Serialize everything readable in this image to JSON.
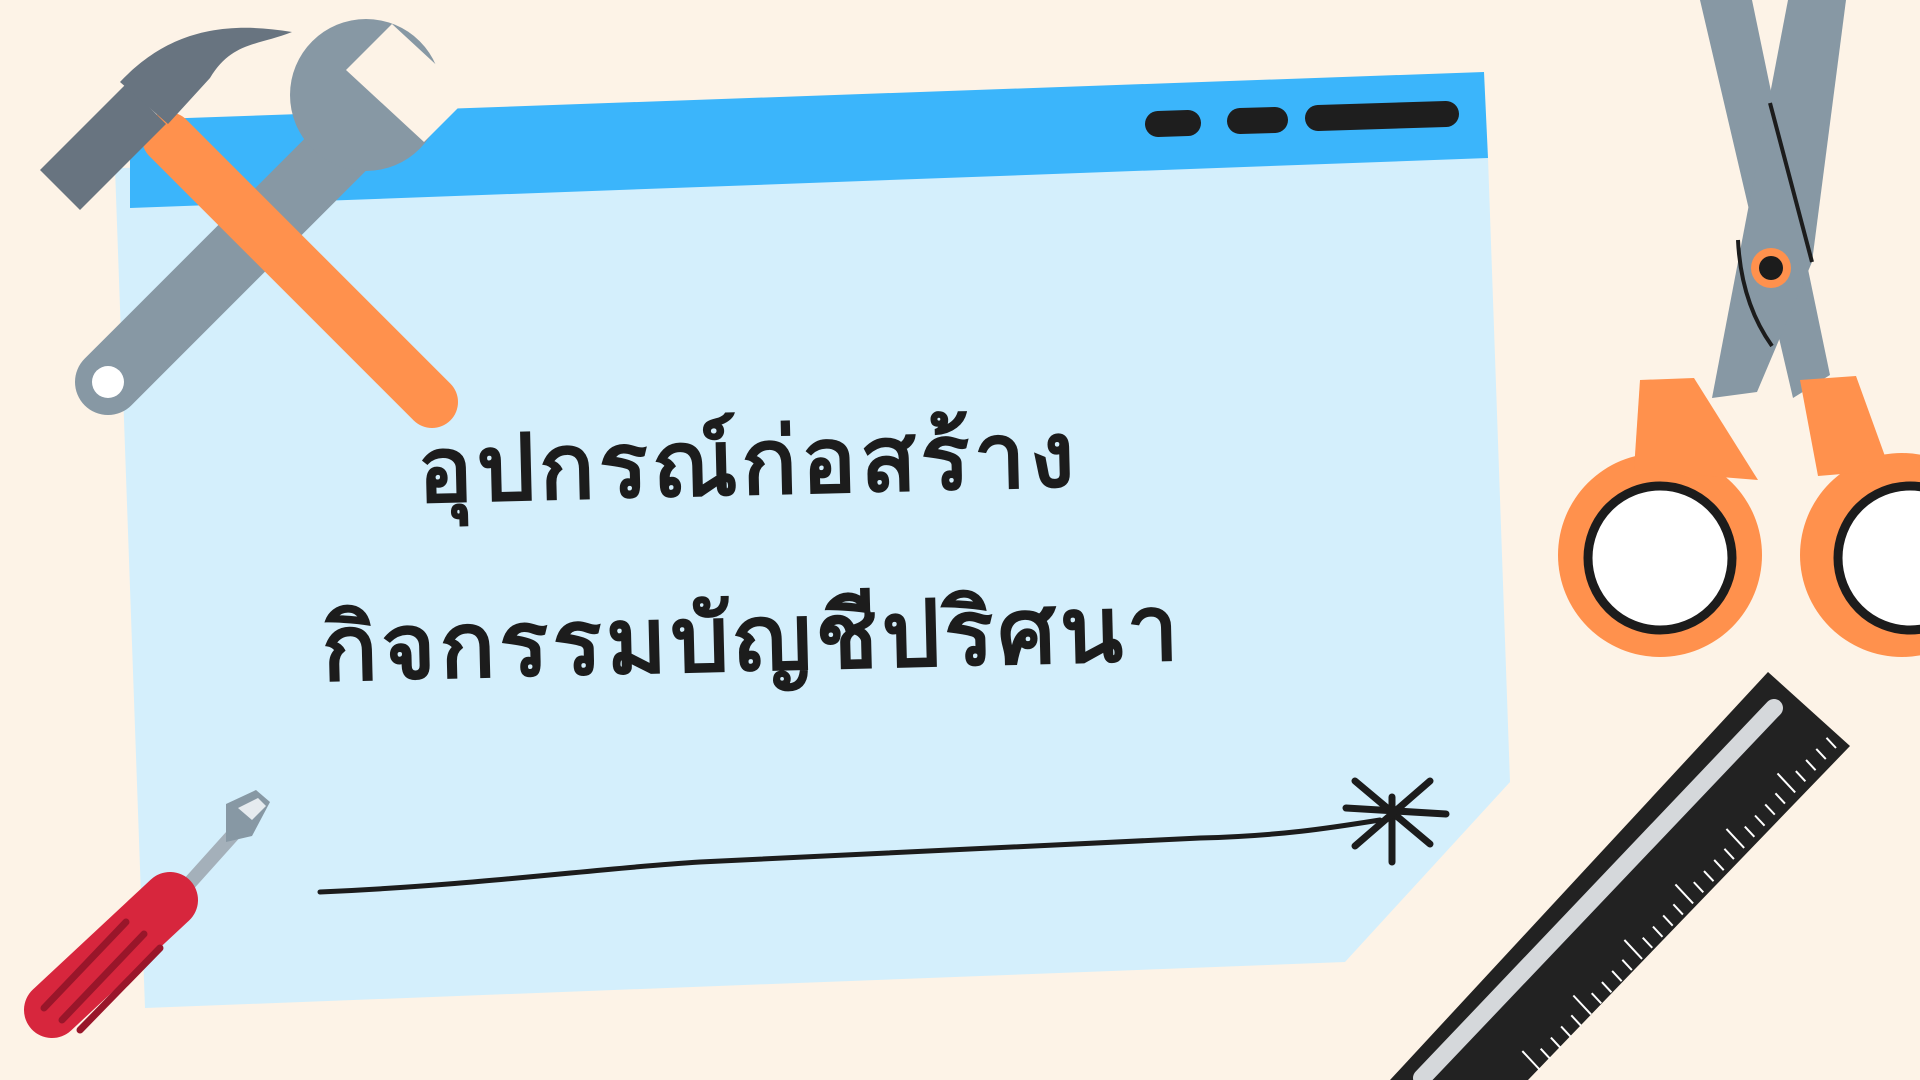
{
  "title": {
    "line1": "อุปกรณ์ก่อสร้าง",
    "line2": "กิจกรรมบัญชีปริศนา",
    "text_color": "#1c1c1c"
  },
  "window": {
    "titlebar_color": "#3bb5fb",
    "body_color": "#d4effc"
  },
  "colors": {
    "background": "#fdf3e7",
    "tool_orange": "#ff914d",
    "tool_gray": "#8798a4",
    "tool_dark_gray": "#687480",
    "screwdriver_red": "#d7263d",
    "ruler_black": "#222222"
  },
  "icons": [
    "hammer-icon",
    "wrench-icon",
    "scissors-icon",
    "screwdriver-icon",
    "ruler-icon",
    "sparkle-icon"
  ]
}
